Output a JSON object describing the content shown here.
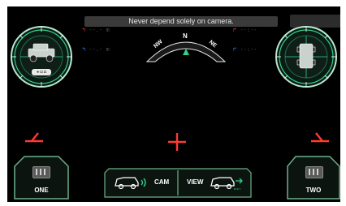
{
  "banner": {
    "warning_text": "Never depend solely on camera."
  },
  "left_gauge": {
    "indicator_label": "● ◘ ◘"
  },
  "right_gauge": {},
  "readouts": {
    "front_left": {
      "value": "--.-",
      "unit": "m"
    },
    "rear_left": {
      "value": "--.-",
      "unit": "m"
    },
    "front_right": {
      "value": "--:--"
    },
    "rear_right": {
      "value": "--:--"
    }
  },
  "compass": {
    "left_label": "NW",
    "center_label": "N",
    "right_label": "NE"
  },
  "buttons": {
    "one_label": "ONE",
    "two_label": "TWO",
    "cam_label": "CAM",
    "view_label": "VIEW"
  },
  "colors": {
    "accent_green": "#2fd28a",
    "marker_red": "#ff3b2f",
    "frame_green": "#6cb08a",
    "compass_arrow": "#2fd28a"
  },
  "icons": {
    "vehicle": "vehicle-side-icon",
    "vehicle_top": "vehicle-top-icon",
    "cam": "camera-signal-icon",
    "view": "view-switch-icon"
  }
}
